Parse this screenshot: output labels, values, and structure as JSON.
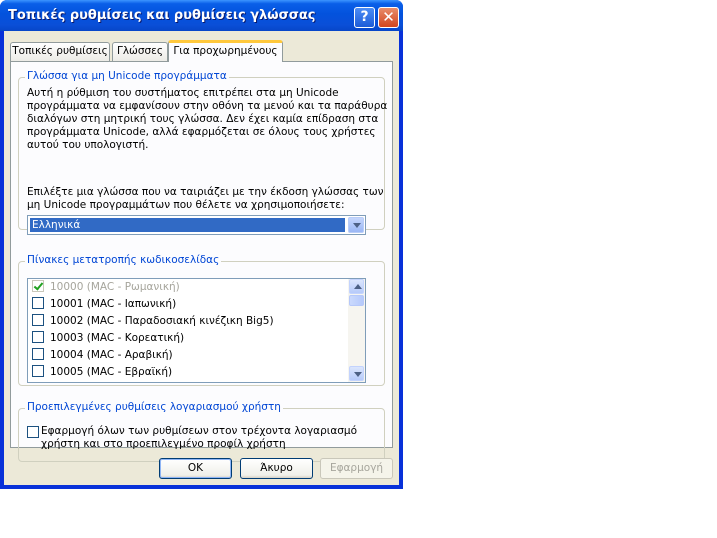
{
  "window": {
    "title": "Τοπικές ρυθμίσεις και ρυθμίσεις γλώσσας",
    "help_label": "?",
    "close_label": "✕"
  },
  "tabs": [
    {
      "label": "Τοπικές ρυθμίσεις",
      "active": false
    },
    {
      "label": "Γλώσσες",
      "active": false
    },
    {
      "label": "Για προχωρημένους",
      "active": true
    }
  ],
  "non_unicode": {
    "legend": "Γλώσσα για μη Unicode προγράμματα",
    "description_lines": [
      "Αυτή η ρύθμιση του συστήματος επιτρέπει στα μη Unicode",
      "προγράμματα να εμφανίσουν στην οθόνη τα μενού και τα παράθυρα",
      "διαλόγων στη μητρική τους γλώσσα. Δεν έχει καμία επίδραση στα",
      "προγράμματα Unicode, αλλά εφαρμόζεται σε όλους τους χρήστες",
      "αυτού του υπολογιστή."
    ],
    "prompt_lines": [
      "Επιλέξτε μια γλώσσα που να ταιριάζει με την έκδοση γλώσσας των",
      "μη Unicode προγραμμάτων που θέλετε να χρησιμοποιήσετε:"
    ],
    "selected_language": "Ελληνικά"
  },
  "code_pages": {
    "legend": "Πίνακες μετατροπής κωδικοσελίδας",
    "items": [
      {
        "label": "10000 (MAC - Ρωμανική)",
        "checked": true,
        "disabled": true
      },
      {
        "label": "10001 (MAC - Ιαπωνική)",
        "checked": false,
        "disabled": false
      },
      {
        "label": "10002 (MAC - Παραδοσιακή κινέζικη Big5)",
        "checked": false,
        "disabled": false
      },
      {
        "label": "10003 (MAC - Κορεατική)",
        "checked": false,
        "disabled": false
      },
      {
        "label": "10004 (MAC - Αραβική)",
        "checked": false,
        "disabled": false
      },
      {
        "label": "10005 (MAC - Εβραϊκή)",
        "checked": false,
        "disabled": false
      }
    ]
  },
  "default_account": {
    "legend": "Προεπιλεγμένες ρυθμίσεις λογαριασμού χρήστη",
    "checkbox_lines": [
      "Εφαρμογή όλων των ρυθμίσεων στον τρέχοντα λογαριασμό",
      "χρήστη και στο προεπιλεγμένο προφίλ χρήστη"
    ],
    "checked": false
  },
  "buttons": {
    "ok": "OK",
    "cancel": "Άκυρο",
    "apply": "Εφαρμογή"
  }
}
